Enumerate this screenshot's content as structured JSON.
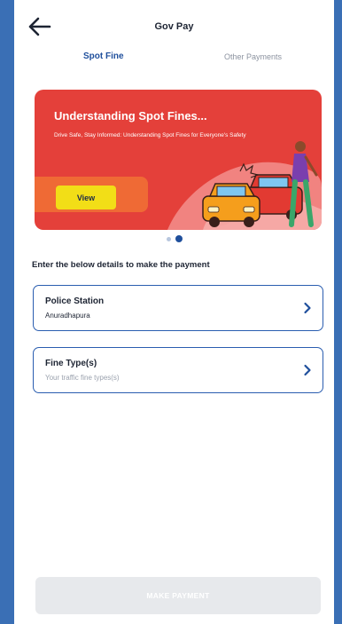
{
  "header": {
    "title": "Gov Pay",
    "back_icon": "arrow-left-icon"
  },
  "tabs": [
    {
      "label": "Spot Fine",
      "active": true
    },
    {
      "label": "Other Payments",
      "active": false
    }
  ],
  "banner": {
    "title": "Understanding Spot Fines...",
    "subtitle": "Drive Safe, Stay Informed: Understanding Spot Fines for Everyone's Safety",
    "button_label": "View",
    "slide_count": 2,
    "active_slide": 2
  },
  "form": {
    "instruction": "Enter the below details to make the payment",
    "police_station": {
      "label": "Police Station",
      "value": "Anuradhapura"
    },
    "fine_type": {
      "label": "Fine Type(s)",
      "placeholder": "Your traffic fine types(s)"
    }
  },
  "footer": {
    "pay_button": "MAKE PAYMENT"
  },
  "colors": {
    "frame": "#3a6fb5",
    "accent": "#1f4f9c",
    "banner": "#e4403a",
    "view_button": "#f2de17",
    "disabled_button": "#e7e9ec"
  }
}
